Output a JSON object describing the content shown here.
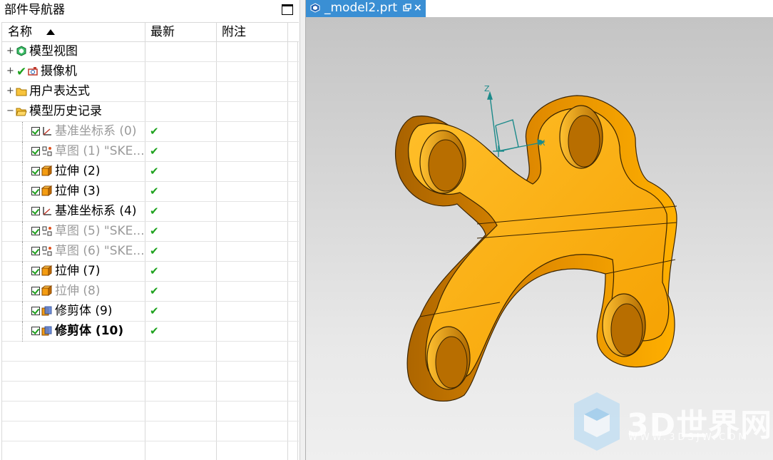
{
  "navigator": {
    "title": "部件导航器",
    "columns": {
      "name": "名称",
      "latest": "最新",
      "note": "附注"
    },
    "rows": [
      {
        "label": "模型视图",
        "style": "normal",
        "icon": "model-views-icon",
        "expand": "+",
        "checked": false,
        "latest": ""
      },
      {
        "label": "摄像机",
        "style": "normal",
        "icon": "camera-icon",
        "expand": "+",
        "checked": false,
        "latest": ""
      },
      {
        "label": "用户表达式",
        "style": "normal",
        "icon": "folder-icon",
        "expand": "+",
        "checked": false,
        "latest": ""
      },
      {
        "label": "模型历史记录",
        "style": "normal",
        "icon": "folder-open-icon",
        "expand": "−",
        "checked": false,
        "latest": ""
      },
      {
        "label": "基准坐标系 (0)",
        "style": "grey",
        "icon": "datum-csys-icon",
        "checked": true,
        "latest": "✔"
      },
      {
        "label": "草图 (1) \"SKE...",
        "style": "grey",
        "icon": "sketch-icon",
        "checked": true,
        "latest": "✔"
      },
      {
        "label": "拉伸 (2)",
        "style": "normal",
        "icon": "extrude-icon",
        "checked": true,
        "latest": "✔"
      },
      {
        "label": "拉伸 (3)",
        "style": "normal",
        "icon": "extrude-icon",
        "checked": true,
        "latest": "✔"
      },
      {
        "label": "基准坐标系 (4)",
        "style": "normal",
        "icon": "datum-csys-icon",
        "checked": true,
        "latest": "✔"
      },
      {
        "label": "草图 (5) \"SKE...",
        "style": "grey",
        "icon": "sketch-icon",
        "checked": true,
        "latest": "✔"
      },
      {
        "label": "草图 (6) \"SKE...",
        "style": "grey",
        "icon": "sketch-icon",
        "checked": true,
        "latest": "✔"
      },
      {
        "label": "拉伸 (7)",
        "style": "normal",
        "icon": "extrude-icon",
        "checked": true,
        "latest": "✔"
      },
      {
        "label": "拉伸 (8)",
        "style": "grey",
        "icon": "extrude-icon",
        "checked": true,
        "latest": "✔"
      },
      {
        "label": "修剪体 (9)",
        "style": "normal",
        "icon": "trim-body-icon",
        "checked": true,
        "latest": "✔"
      },
      {
        "label": "修剪体 (10)",
        "style": "bold",
        "icon": "trim-body-icon",
        "checked": true,
        "latest": "✔"
      }
    ]
  },
  "viewport": {
    "tab_title": "_model2.prt",
    "close_glyph": "×",
    "axis_labels": {
      "z": "Z",
      "x": "X"
    },
    "watermark": {
      "brand": "3D世界网",
      "url": "WWW.3DSJW.COM"
    },
    "colors": {
      "part_light": "#ffb000",
      "part_mid": "#f59a00",
      "part_dark": "#c97a00",
      "tab": "#3a8fd4",
      "axis": "#1c8a8a"
    }
  }
}
